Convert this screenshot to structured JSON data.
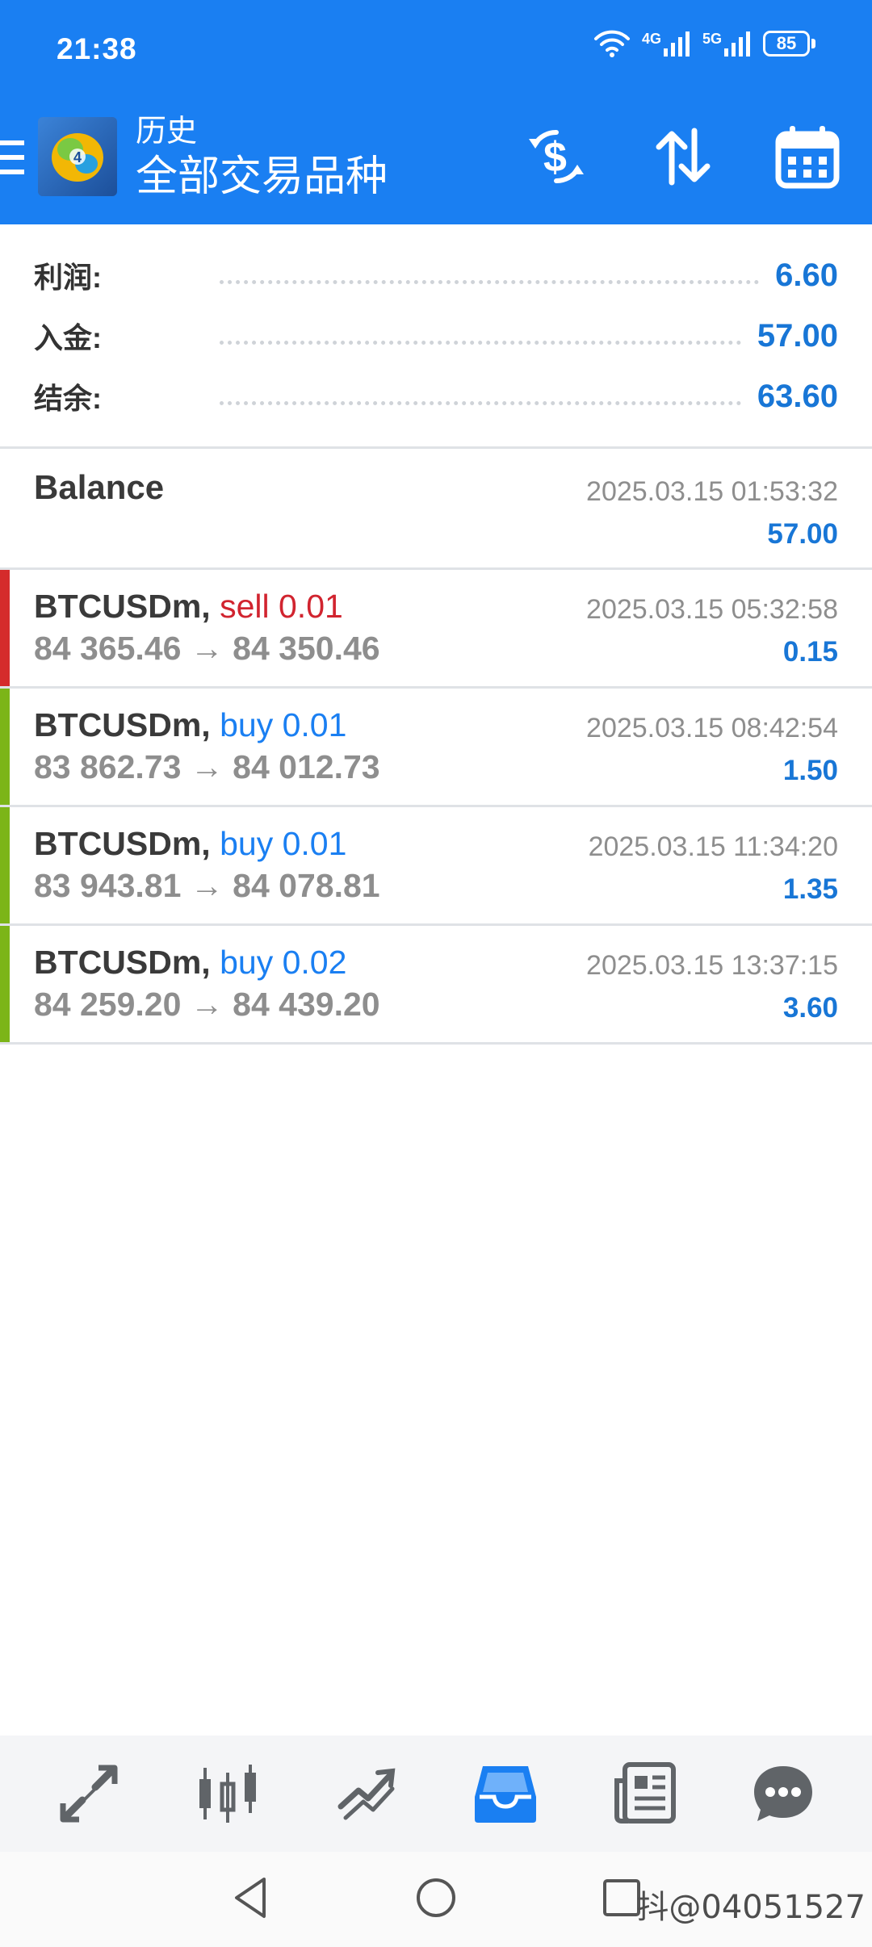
{
  "status_bar": {
    "time": "21:38",
    "signal_1": "4G",
    "signal_2": "5G",
    "battery": "85"
  },
  "header": {
    "subtitle": "历史",
    "title": "全部交易品种",
    "icons": [
      "menu-icon",
      "app-logo",
      "currency-exchange-icon",
      "sort-icon",
      "calendar-icon"
    ],
    "accent_color": "#1a7ff2"
  },
  "summary": {
    "profit_label": "利润:",
    "profit_value": "6.60",
    "deposit_label": "入金:",
    "deposit_value": "57.00",
    "balance_label": "结余:",
    "balance_value": "63.60"
  },
  "balance_entry": {
    "label": "Balance",
    "time": "2025.03.15 01:53:32",
    "amount": "57.00"
  },
  "deals": [
    {
      "symbol": "BTCUSDm,",
      "direction": "sell 0.01",
      "prices": "84 365.46 → 84 350.46",
      "time": "2025.03.15 05:32:58",
      "profit": "0.15",
      "side_color": "#d52b2b"
    },
    {
      "symbol": "BTCUSDm,",
      "direction": "buy 0.01",
      "prices": "83 862.73 → 84 012.73",
      "time": "2025.03.15 08:42:54",
      "profit": "1.50",
      "side_color": "#7cb518"
    },
    {
      "symbol": "BTCUSDm,",
      "direction": "buy 0.01",
      "prices": "83 943.81 → 84 078.81",
      "time": "2025.03.15 11:34:20",
      "profit": "1.35",
      "side_color": "#7cb518"
    },
    {
      "symbol": "BTCUSDm,",
      "direction": "buy 0.02",
      "prices": "84 259.20 → 84 439.20",
      "time": "2025.03.15 13:37:15",
      "profit": "3.60",
      "side_color": "#7cb518"
    }
  ],
  "bottom_nav": {
    "items": [
      "quotes-icon",
      "chart-icon",
      "trade-icon",
      "history-icon",
      "news-icon",
      "messages-icon"
    ],
    "active": "history-icon"
  },
  "system_nav": {
    "items": [
      "back-icon",
      "home-icon",
      "recents-icon"
    ]
  },
  "watermark": "抖@04051527"
}
